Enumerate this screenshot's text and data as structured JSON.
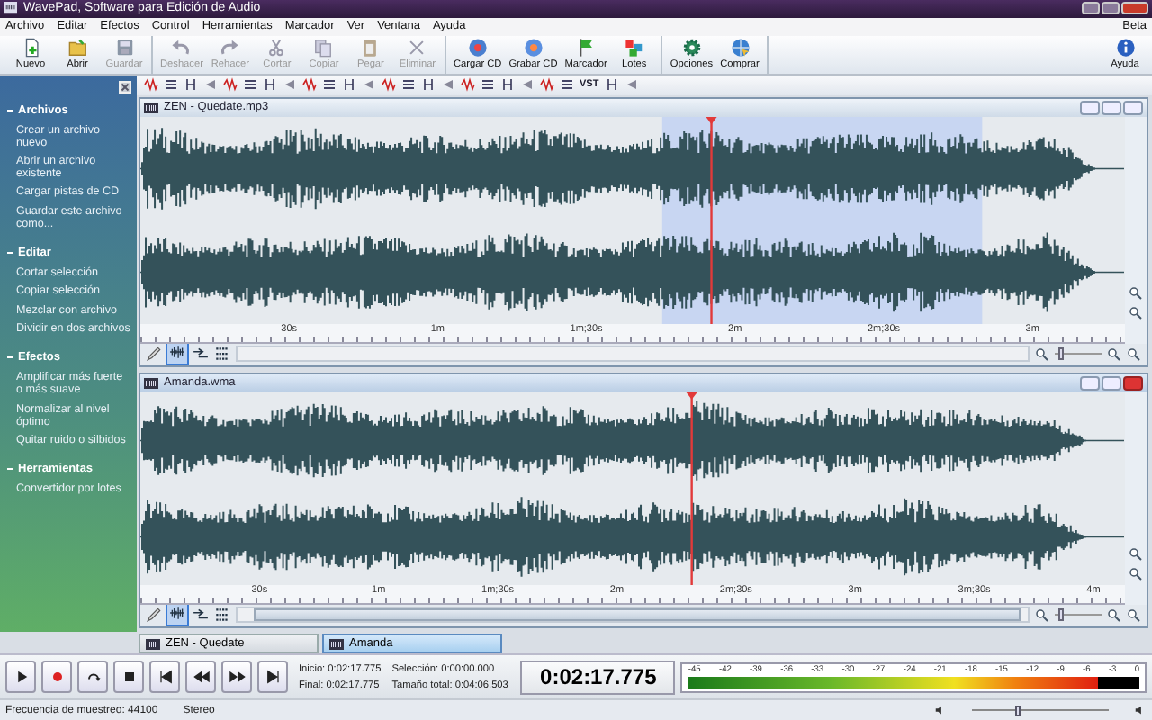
{
  "window": {
    "title": "WavePad, Software para Edición de Audio"
  },
  "menu": [
    "Archivo",
    "Editar",
    "Efectos",
    "Control",
    "Herramientas",
    "Marcador",
    "Ver",
    "Ventana",
    "Ayuda"
  ],
  "edition_label": "Beta",
  "toolbar": {
    "groups": [
      [
        {
          "label": "Nuevo",
          "disabled": false
        },
        {
          "label": "Abrir",
          "disabled": false
        },
        {
          "label": "Guardar",
          "disabled": true
        }
      ],
      [
        {
          "label": "Deshacer",
          "disabled": true
        },
        {
          "label": "Rehacer",
          "disabled": true
        },
        {
          "label": "Cortar",
          "disabled": true
        },
        {
          "label": "Copiar",
          "disabled": true
        },
        {
          "label": "Pegar",
          "disabled": true
        },
        {
          "label": "Eliminar",
          "disabled": true
        }
      ],
      [
        {
          "label": "Cargar CD",
          "disabled": false
        },
        {
          "label": "Grabar CD",
          "disabled": false
        },
        {
          "label": "Marcador",
          "disabled": false
        },
        {
          "label": "Lotes",
          "disabled": false
        }
      ],
      [
        {
          "label": "Opciones",
          "disabled": false
        },
        {
          "label": "Comprar",
          "disabled": false
        }
      ]
    ],
    "help": {
      "label": "Ayuda"
    }
  },
  "sidebar": {
    "sections": [
      {
        "title": "Archivos",
        "items": [
          "Crear un archivo nuevo",
          "Abrir un archivo existente",
          "Cargar pistas de CD",
          "Guardar este archivo como..."
        ]
      },
      {
        "title": "Editar",
        "items": [
          "Cortar selección",
          "Copiar selección",
          "Mezclar con archivo",
          "Dividir en dos archivos"
        ]
      },
      {
        "title": "Efectos",
        "items": [
          "Amplificar más fuerte o más suave",
          "Normalizar al nivel óptimo",
          "Quitar ruido o silbidos"
        ]
      },
      {
        "title": "Herramientas",
        "items": [
          "Convertidor por lotes"
        ]
      }
    ]
  },
  "edit_toolbar": {
    "vst_label": "VST"
  },
  "tracks": [
    {
      "title": "ZEN - Quedate.mp3",
      "active": false,
      "zoom": {
        "level": 0.1
      },
      "scrollbar_thumb": false,
      "ruler": [
        "30s",
        "1m",
        "1m;30s",
        "2m",
        "2m;30s",
        "3m"
      ]
    },
    {
      "title": "Amanda.wma",
      "active": true,
      "zoom": {
        "level": 0.1
      },
      "scrollbar_thumb": true,
      "ruler": [
        "30s",
        "1m",
        "1m;30s",
        "2m",
        "2m;30s",
        "3m",
        "3m;30s",
        "4m"
      ]
    }
  ],
  "document_tabs": [
    {
      "label": "ZEN - Quedate",
      "selected": false
    },
    {
      "label": "Amanda",
      "selected": true
    }
  ],
  "transport": {
    "times": [
      "Inicio: 0:02:17.775",
      "Selección: 0:00:00.000",
      "Final: 0:02:17.775",
      "Tamaño total: 0:04:06.503"
    ],
    "display": "0:02:17.775",
    "meter": {
      "scale": [
        "-45",
        "-42",
        "-39",
        "-36",
        "-33",
        "-30",
        "-27",
        "-24",
        "-21",
        "-18",
        "-15",
        "-12",
        "-9",
        "-6",
        "-3",
        "0"
      ],
      "level": 0.91
    }
  },
  "status_bar": {
    "sample_rate": "Frecuencia de muestreo: 44100",
    "channels": "Stereo",
    "volume": {
      "level": 0.33
    }
  }
}
